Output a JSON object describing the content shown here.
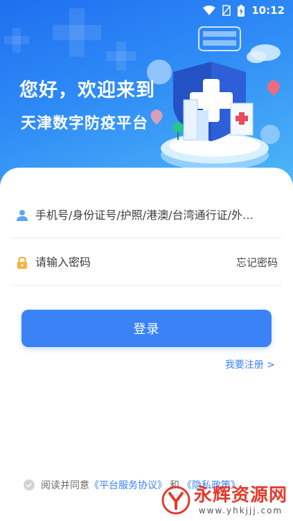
{
  "status_bar": {
    "time": "10:12",
    "icons": [
      "wifi-icon",
      "no-sim-icon",
      "battery-charging-icon"
    ]
  },
  "hero": {
    "greeting": "您好，欢迎来到",
    "platform_name": "天津数字防疫平台"
  },
  "login_form": {
    "account_placeholder": "手机号/身份证号/护照/港澳/台湾通行证/外…",
    "account_icon": "user-icon",
    "password_placeholder": "请输入密码",
    "password_icon": "lock-icon",
    "forgot_label": "忘记密码",
    "login_label": "登录",
    "register_label": "我要注册 >"
  },
  "agreement": {
    "prefix": "阅读并同意",
    "service_link": "《平台服务协议》",
    "conjunction": "和",
    "privacy_link": "《隐私政策》"
  },
  "watermark": {
    "title": "永辉资源网",
    "url": "www.yhkjjj.com"
  },
  "colors": {
    "primary": "#3b82f6",
    "hero_gradient_start": "#1f6ff0",
    "hero_gradient_end": "#4fb7f6",
    "watermark_red": "#e23b2e"
  }
}
